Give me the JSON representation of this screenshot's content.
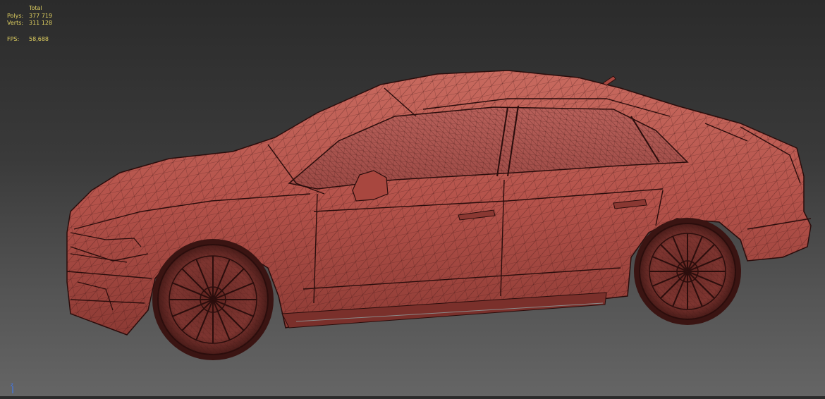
{
  "stats": {
    "header": "Total",
    "polys_label": "Polys:",
    "polys_value": "377 719",
    "verts_label": "Verts:",
    "verts_value": "311 128",
    "fps_label": "FPS:",
    "fps_value": "58,688"
  },
  "viewport": {
    "background_top": "#2b2b2b",
    "background_bottom": "#656565",
    "model_color": "#b4524a",
    "wire_color": "#3a1412",
    "stats_color": "#e0d060",
    "gizmo_axis_label": "z"
  }
}
